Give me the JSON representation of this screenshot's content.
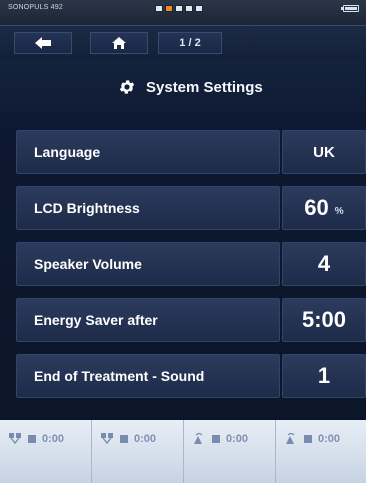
{
  "device": {
    "model": "SONOPULS 492"
  },
  "status": {
    "channel_indicator_active": 2,
    "channel_indicator_count": 5,
    "battery_level": 1.0
  },
  "nav": {
    "page_indicator": "1 / 2"
  },
  "header": {
    "title": "System Settings",
    "icon": "gear-icon"
  },
  "settings": [
    {
      "label": "Language",
      "value": "UK",
      "unit": ""
    },
    {
      "label": "LCD Brightness",
      "value": "60",
      "unit": "%"
    },
    {
      "label": "Speaker Volume",
      "value": "4",
      "unit": ""
    },
    {
      "label": "Energy Saver after",
      "value": "5:00",
      "unit": ""
    },
    {
      "label": "End of Treatment - Sound",
      "value": "1",
      "unit": ""
    }
  ],
  "channels": [
    {
      "icon": "electrode-y1-icon",
      "time": "0:00"
    },
    {
      "icon": "electrode-y2-icon",
      "time": "0:00"
    },
    {
      "icon": "ultrasound-a-icon",
      "time": "0:00"
    },
    {
      "icon": "ultrasound-b-icon",
      "time": "0:00"
    }
  ],
  "colors": {
    "accent": "#f0891f",
    "background": "#0f1a2e",
    "panel": "#243456"
  }
}
